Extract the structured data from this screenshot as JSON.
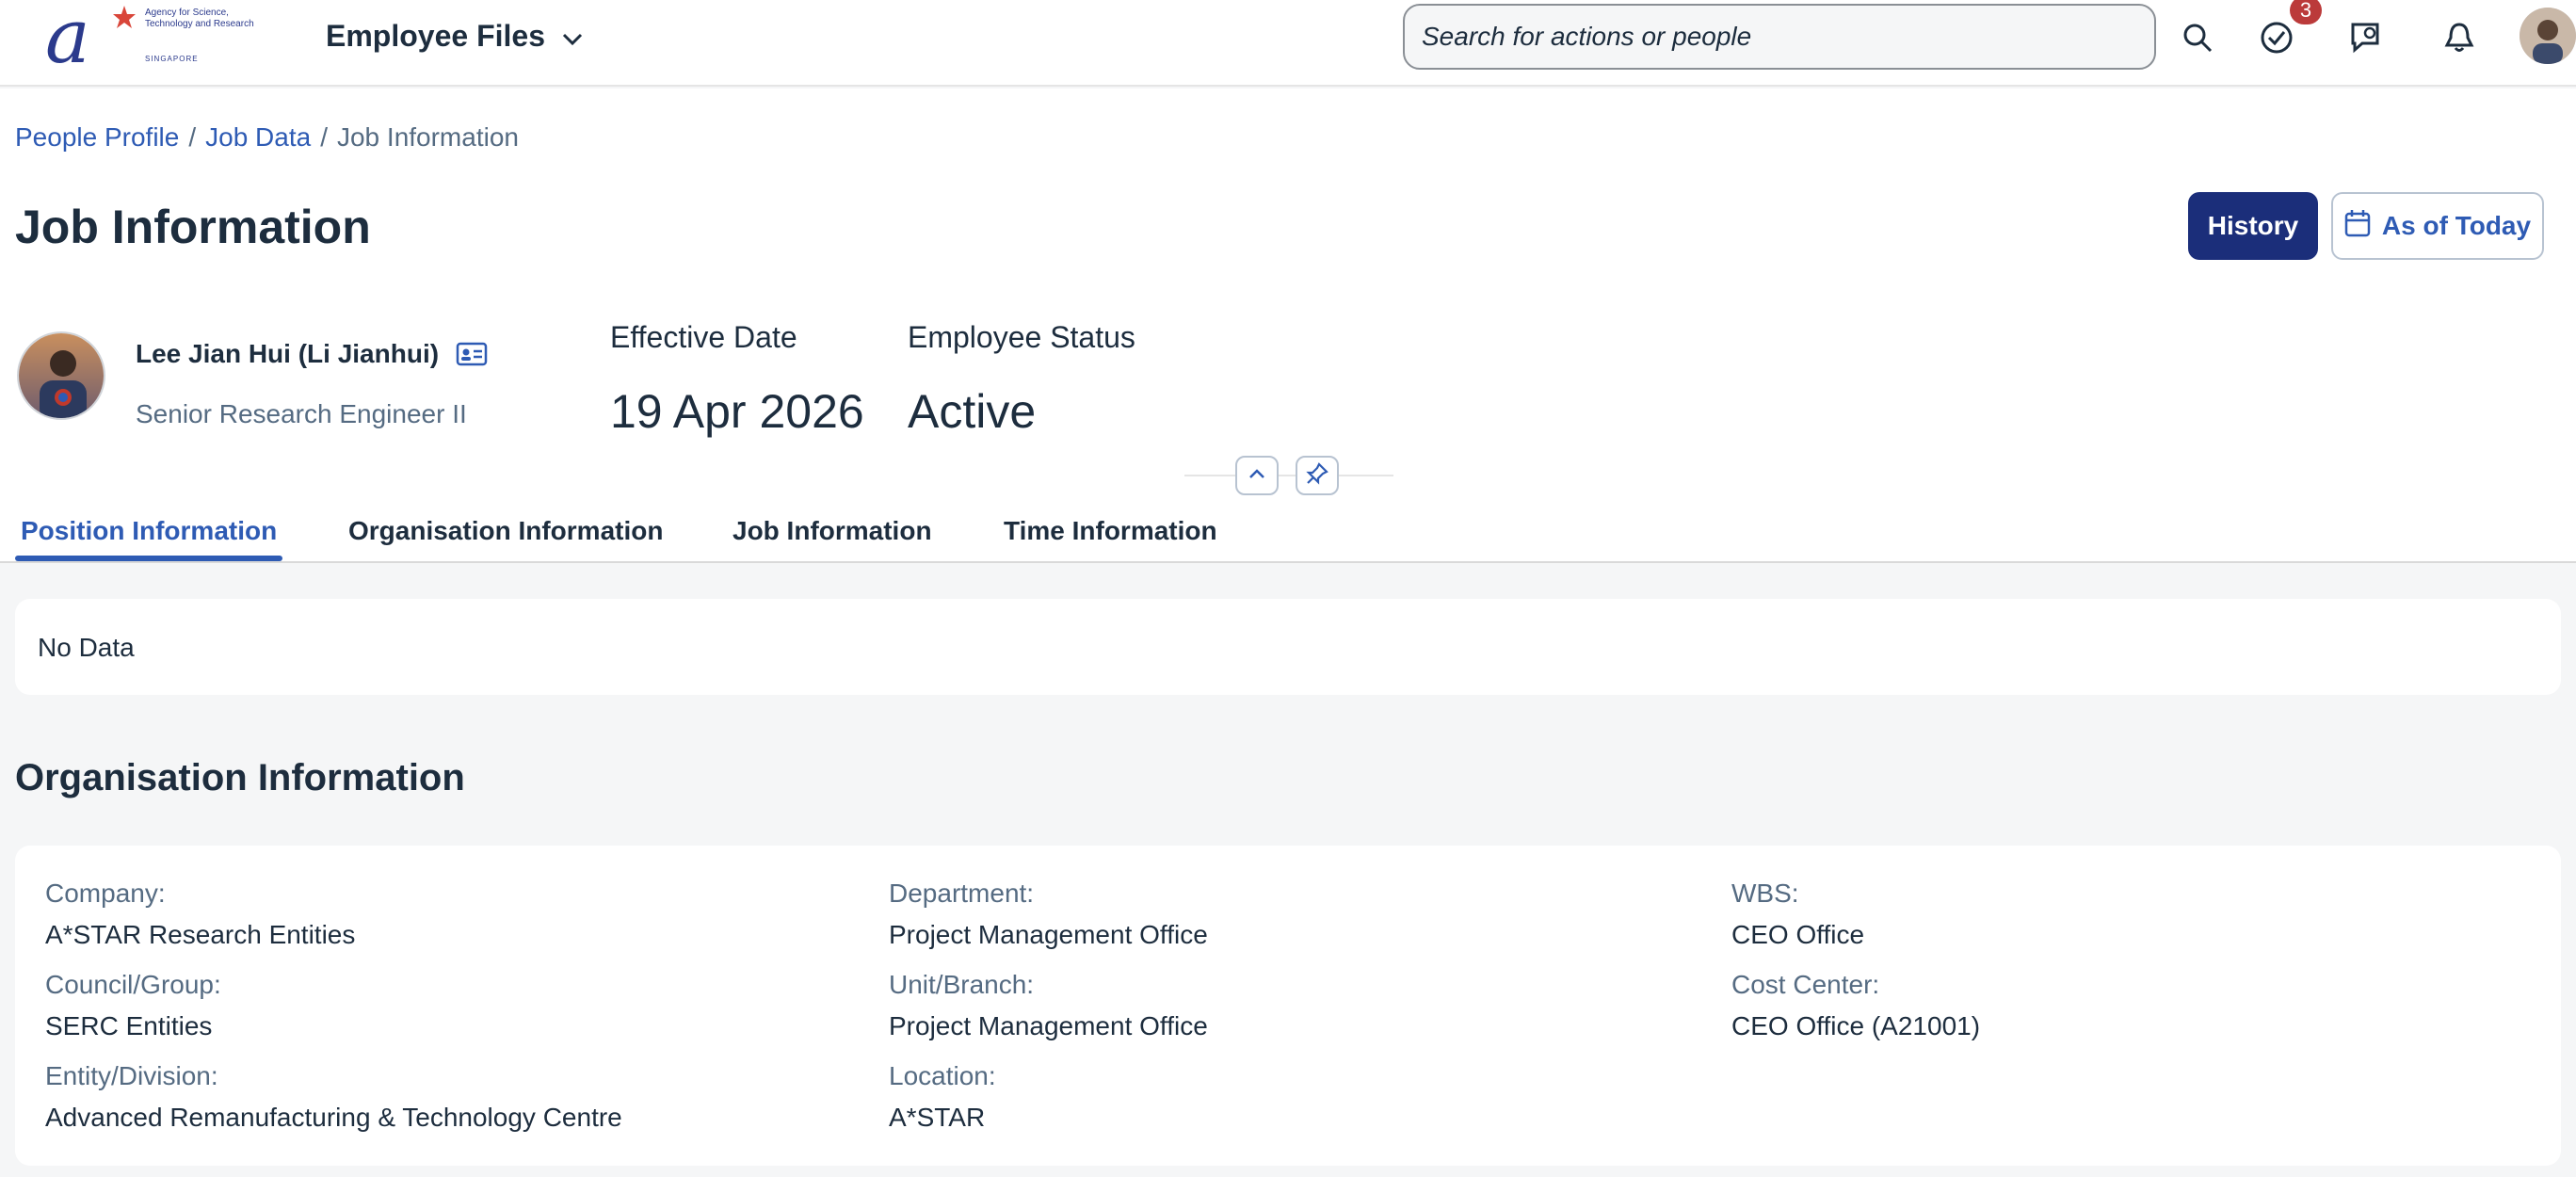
{
  "shell": {
    "logo_text": "Agency for Science, Technology and Research",
    "logo_sub": "SINGAPORE",
    "app_title": "Employee Files",
    "search_placeholder": "Search for actions or people",
    "tasks_badge": "3",
    "icons": [
      "search-icon",
      "tasks-icon",
      "chat-icon",
      "bell-icon",
      "user-avatar"
    ]
  },
  "breadcrumb": {
    "items": [
      "People Profile",
      "Job Data",
      "Job Information"
    ],
    "separator": "/"
  },
  "page": {
    "title": "Job Information",
    "history_label": "History",
    "as_of_label": "As of Today"
  },
  "employee": {
    "name": "Lee Jian Hui (Li Jianhui)",
    "job_title": "Senior Research Engineer II",
    "effective_date_label": "Effective Date",
    "effective_date": "19 Apr 2026",
    "status_label": "Employee Status",
    "status": "Active"
  },
  "tabs": [
    {
      "label": "Position Information",
      "active": true
    },
    {
      "label": "Organisation Information",
      "active": false
    },
    {
      "label": "Job Information",
      "active": false
    },
    {
      "label": "Time Information",
      "active": false
    }
  ],
  "position_section": {
    "no_data": "No Data"
  },
  "organisation_section": {
    "title": "Organisation Information",
    "fields": [
      {
        "label": "Company:",
        "value": "A*STAR Research Entities"
      },
      {
        "label": "Council/Group:",
        "value": "SERC Entities"
      },
      {
        "label": "Entity/Division:",
        "value": "Advanced Remanufacturing & Technology Centre"
      },
      {
        "label": "Department:",
        "value": "Project Management Office"
      },
      {
        "label": "Unit/Branch:",
        "value": "Project Management Office"
      },
      {
        "label": "Location:",
        "value": "A*STAR"
      },
      {
        "label": "WBS:",
        "value": "CEO Office"
      },
      {
        "label": "Cost Center:",
        "value": "CEO Office (A21001)"
      }
    ]
  },
  "colors": {
    "accent": "#2e5bb4",
    "primary_button": "#1b2e7a",
    "badge": "#bb3a3a",
    "page_bg": "#f5f6f7"
  }
}
